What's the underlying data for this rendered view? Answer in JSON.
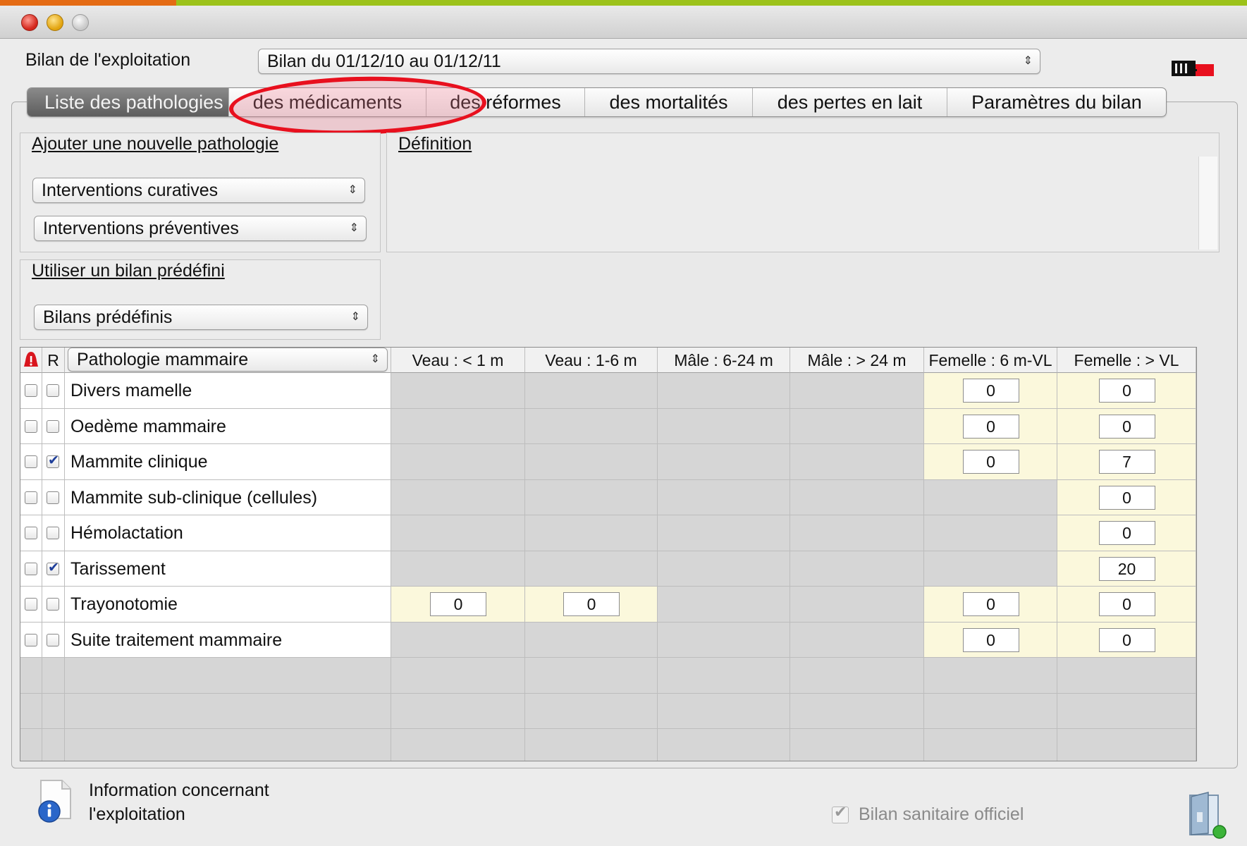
{
  "window": {
    "controls": [
      "close",
      "minimize",
      "zoom"
    ]
  },
  "header": {
    "label": "Bilan de l'exploitation",
    "period_select": "Bilan du 01/12/10 au 01/12/11"
  },
  "tabs": [
    {
      "label": "Liste des pathologies",
      "active": true
    },
    {
      "label": "des médicaments",
      "active": false
    },
    {
      "label": "des réformes",
      "active": false
    },
    {
      "label": "des mortalités",
      "active": false
    },
    {
      "label": "des pertes en lait",
      "active": false
    },
    {
      "label": "Paramètres du bilan",
      "active": false
    }
  ],
  "add_section": {
    "title": "Ajouter une nouvelle pathologie",
    "curative_select": "Interventions curatives",
    "preventive_select": "Interventions préventives"
  },
  "definition": {
    "title": "Définition"
  },
  "predefined": {
    "title": "Utiliser un bilan prédéfini",
    "select": "Bilans prédéfinis"
  },
  "table": {
    "alert_header_icon": "warning-icon",
    "r_header": "R",
    "category_select": "Pathologie mammaire",
    "columns": [
      "Veau : < 1 m",
      "Veau : 1-6 m",
      "Mâle : 6-24 m",
      "Mâle : > 24 m",
      "Femelle : 6 m-VL",
      "Femelle : > VL"
    ],
    "rows": [
      {
        "name": "Divers mamelle",
        "alert": false,
        "r": false,
        "values": [
          null,
          null,
          null,
          null,
          "0",
          "0"
        ]
      },
      {
        "name": "Oedème mammaire",
        "alert": false,
        "r": false,
        "values": [
          null,
          null,
          null,
          null,
          "0",
          "0"
        ]
      },
      {
        "name": "Mammite clinique",
        "alert": false,
        "r": true,
        "values": [
          null,
          null,
          null,
          null,
          "0",
          "7"
        ]
      },
      {
        "name": "Mammite sub-clinique (cellules)",
        "alert": false,
        "r": false,
        "values": [
          null,
          null,
          null,
          null,
          null,
          "0"
        ]
      },
      {
        "name": "Hémolactation",
        "alert": false,
        "r": false,
        "values": [
          null,
          null,
          null,
          null,
          null,
          "0"
        ]
      },
      {
        "name": "Tarissement",
        "alert": false,
        "r": true,
        "values": [
          null,
          null,
          null,
          null,
          null,
          "20"
        ]
      },
      {
        "name": "Trayonotomie",
        "alert": false,
        "r": false,
        "values": [
          "0",
          "0",
          null,
          null,
          "0",
          "0"
        ]
      },
      {
        "name": "Suite traitement mammaire",
        "alert": false,
        "r": false,
        "values": [
          null,
          null,
          null,
          null,
          "0",
          "0"
        ]
      }
    ],
    "empty_rows": 3
  },
  "footer": {
    "info_line1": "Information concernant",
    "info_line2": "l'exploitation",
    "official_label": "Bilan sanitaire officiel",
    "official_checked": true
  },
  "colors": {
    "annotation_red": "#e8101e",
    "active_tab": "#6f6f6f",
    "editable_cell": "#fbf8dc",
    "disabled_cell": "#d6d6d6",
    "checkbox_mark": "#1f3f9a"
  }
}
